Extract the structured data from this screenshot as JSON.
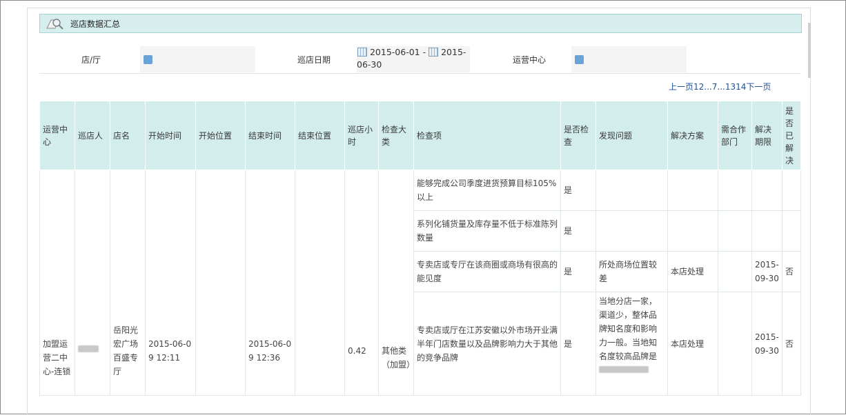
{
  "panel": {
    "title": "巡店数据汇总",
    "icon": "magnifier-document-icon"
  },
  "filters": {
    "store_label": "店/厅",
    "date_label": "巡店日期",
    "date_start": "2015-06-01",
    "date_sep": "-",
    "date_end_part1": "2015-",
    "date_end_part2": "06-30",
    "ops_label": "运营中心"
  },
  "pager": {
    "prev": "上一页",
    "p1": "1",
    "p2": "2",
    "e1": "...",
    "p7": "7",
    "e2": "...",
    "p13": "13",
    "p14": "14",
    "next": "下一页"
  },
  "columns": [
    "运营中心",
    "巡店人",
    "店名",
    "开始时间",
    "开始位置",
    "结束时间",
    "结束位置",
    "巡店小时",
    "检查大类",
    "检查项",
    "是否检查",
    "发现问题",
    "解决方案",
    "需合作部门",
    "解决期限",
    "是否已解决"
  ],
  "record": {
    "ops_center": "加盟运营二中心-连锁",
    "store": "岳阳光宏广场百盛专厅",
    "start_time": "2015-06-09 12:11",
    "end_time": "2015-06-09 12:36",
    "hours": "0.42",
    "category": "其他类（加盟）"
  },
  "items": [
    {
      "item": "能够完成公司季度进货预算目标105%以上",
      "checked": "是",
      "problem": "",
      "solution": "",
      "dept": "",
      "deadline": "",
      "resolved": ""
    },
    {
      "item": "系列化铺货量及库存量不低于标准陈列数量",
      "checked": "是",
      "problem": "",
      "solution": "",
      "dept": "",
      "deadline": "",
      "resolved": ""
    },
    {
      "item": "专卖店或专厅在该商圈或商场有很高的能见度",
      "checked": "是",
      "problem": "所处商场位置较差",
      "solution": "本店处理",
      "dept": "",
      "deadline": "2015-09-30",
      "resolved": "否"
    },
    {
      "item": "专卖店或厅在江苏安徽以外市场开业满半年门店数量以及品牌影响力大于其他的竞争品牌",
      "checked": "是",
      "problem": "当地分店一家，渠道少，整体品牌知名度和影响力一般。当地知名度较高品牌是",
      "solution": "本店处理",
      "dept": "",
      "deadline": "2015-09-30",
      "resolved": "否"
    }
  ]
}
